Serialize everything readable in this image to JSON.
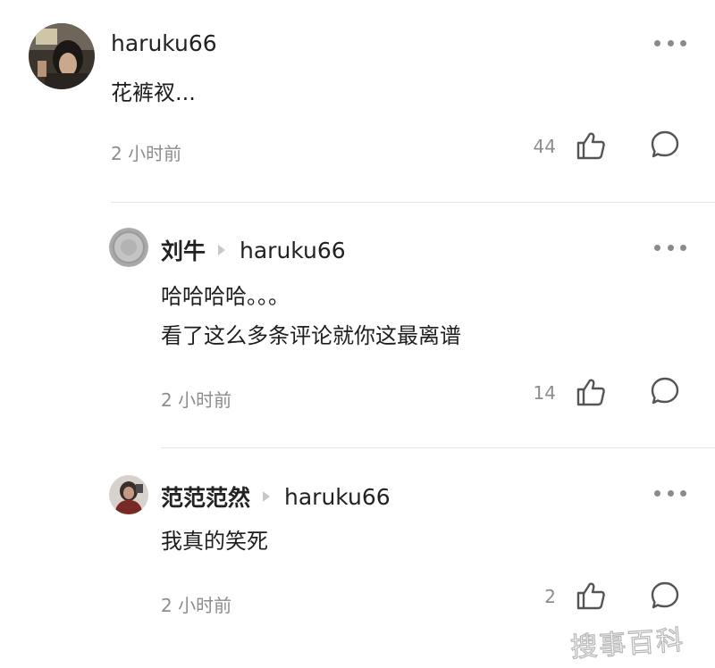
{
  "comments": [
    {
      "author": "haruku66",
      "reply_to": "",
      "text_lines": [
        "花裤衩..."
      ],
      "time": "2 小时前",
      "likes": "44"
    },
    {
      "author": "刘牛",
      "reply_to": "haruku66",
      "text_lines": [
        "哈哈哈哈。。。",
        "看了这么多条评论就你这最离谱"
      ],
      "time": "2 小时前",
      "likes": "14"
    },
    {
      "author": "范范范然",
      "reply_to": "haruku66",
      "text_lines": [
        "我真的笑死"
      ],
      "time": "2 小时前",
      "likes": "2"
    }
  ],
  "watermark": "搜事百科",
  "colors": {
    "text": "#1e1e1e",
    "meta": "#8c8c8c",
    "divider": "#e3e3e3"
  },
  "icons": {
    "more": "more-dots-icon",
    "like": "thumbs-up-icon",
    "reply": "comment-bubble-icon",
    "reply_arrow": "reply-arrow-icon"
  }
}
